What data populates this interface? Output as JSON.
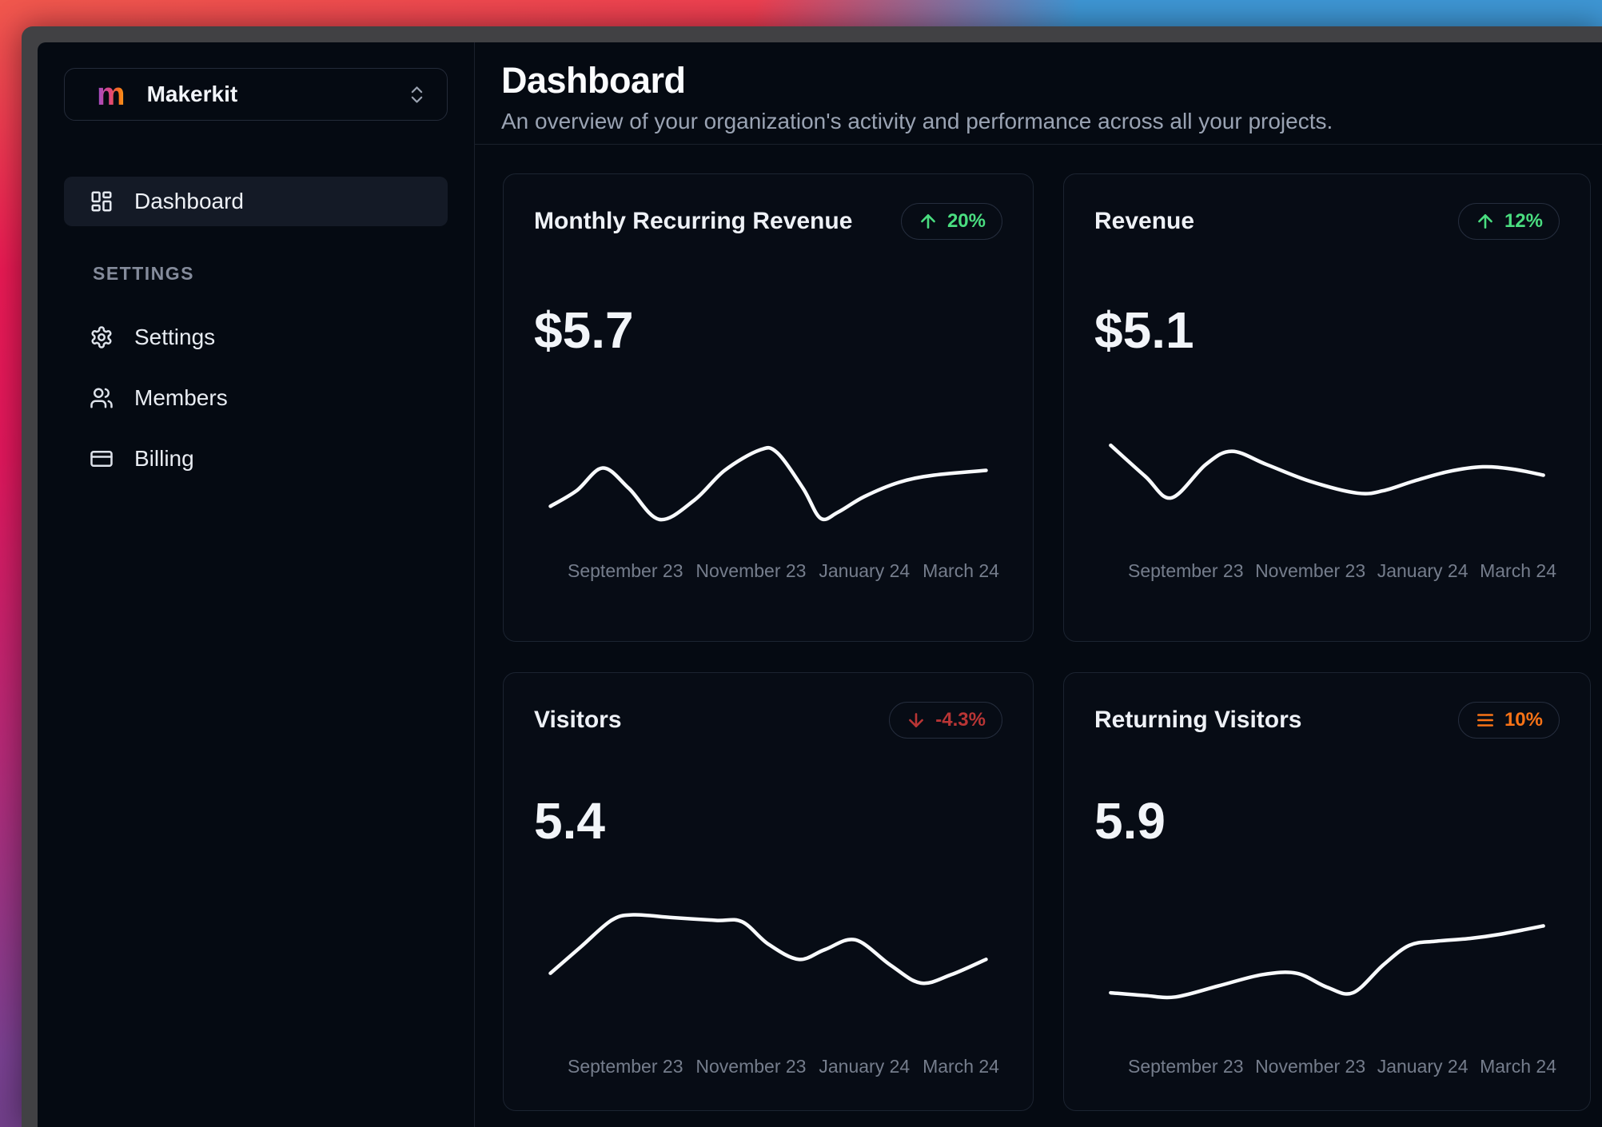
{
  "wallpaper": {
    "left_edge_colors": [
      "#f0584d",
      "#ea1a54",
      "#e0175c",
      "#b52a78",
      "#7a4192",
      "#53396f"
    ],
    "top_right_color": "#3e96d4"
  },
  "sidebar": {
    "workspace_selector": {
      "logo_letter": "m",
      "name": "Makerkit"
    },
    "nav": [
      {
        "label": "Dashboard",
        "icon": "layout-dashboard-icon",
        "active": true
      }
    ],
    "section_label": "SETTINGS",
    "settings_nav": [
      {
        "label": "Settings",
        "icon": "gear-icon"
      },
      {
        "label": "Members",
        "icon": "users-icon"
      },
      {
        "label": "Billing",
        "icon": "credit-card-icon"
      }
    ]
  },
  "header": {
    "title": "Dashboard",
    "subtitle": "An overview of your organization's activity and performance across all your projects."
  },
  "colors": {
    "trend_up": "#4ade80",
    "trend_down": "#b93535",
    "trend_flat": "#f97316",
    "spark_line": "#f8fafc"
  },
  "chart_data": [
    {
      "type": "line",
      "title": "Monthly Recurring Revenue",
      "value": "$5.7",
      "trend": {
        "icon": "arrow-up",
        "label": "20%",
        "color": "#4ade80"
      },
      "x_ticks": [
        "September 23",
        "November 23",
        "January 24",
        "March 24"
      ],
      "points_format": "[x percent of chart width, y percent of chart height (no numeric axis shown)]",
      "points_pct": [
        [
          0,
          25
        ],
        [
          6,
          38
        ],
        [
          12,
          57
        ],
        [
          18,
          40
        ],
        [
          25,
          14
        ],
        [
          33,
          30
        ],
        [
          40,
          55
        ],
        [
          48,
          72
        ],
        [
          52,
          70
        ],
        [
          58,
          40
        ],
        [
          62,
          15
        ],
        [
          66,
          20
        ],
        [
          72,
          33
        ],
        [
          80,
          45
        ],
        [
          88,
          51
        ],
        [
          100,
          55
        ]
      ]
    },
    {
      "type": "line",
      "title": "Revenue",
      "value": "$5.1",
      "trend": {
        "icon": "arrow-up",
        "label": "12%",
        "color": "#4ade80"
      },
      "x_ticks": [
        "September 23",
        "November 23",
        "January 24",
        "March 24"
      ],
      "points_format": "[x percent of chart width, y percent of chart height (no numeric axis shown)]",
      "points_pct": [
        [
          0,
          76
        ],
        [
          8,
          50
        ],
        [
          14,
          32
        ],
        [
          22,
          60
        ],
        [
          28,
          71
        ],
        [
          36,
          60
        ],
        [
          46,
          46
        ],
        [
          57,
          36
        ],
        [
          63,
          38
        ],
        [
          70,
          46
        ],
        [
          78,
          54
        ],
        [
          86,
          58
        ],
        [
          93,
          56
        ],
        [
          100,
          51
        ]
      ]
    },
    {
      "type": "line",
      "title": "Visitors",
      "value": "5.4",
      "trend": {
        "icon": "arrow-down",
        "label": "-4.3%",
        "color": "#b93535"
      },
      "x_ticks": [
        "September 23",
        "November 23",
        "January 24",
        "March 24"
      ],
      "points_format": "[x percent of chart width, y percent of chart height (no numeric axis shown)]",
      "points_pct": [
        [
          0,
          41
        ],
        [
          7,
          60
        ],
        [
          14,
          79
        ],
        [
          19,
          83
        ],
        [
          28,
          81
        ],
        [
          38,
          79
        ],
        [
          44,
          78
        ],
        [
          50,
          62
        ],
        [
          57,
          51
        ],
        [
          63,
          58
        ],
        [
          70,
          65
        ],
        [
          78,
          47
        ],
        [
          85,
          34
        ],
        [
          92,
          40
        ],
        [
          100,
          51
        ]
      ]
    },
    {
      "type": "line",
      "title": "Returning Visitors",
      "value": "5.9",
      "trend": {
        "icon": "menu",
        "label": "10%",
        "color": "#f97316"
      },
      "x_ticks": [
        "September 23",
        "November 23",
        "January 24",
        "March 24"
      ],
      "points_format": "[x percent of chart width, y percent of chart height (no numeric axis shown)]",
      "points_pct": [
        [
          0,
          27
        ],
        [
          8,
          25
        ],
        [
          15,
          24
        ],
        [
          25,
          32
        ],
        [
          35,
          40
        ],
        [
          43,
          41
        ],
        [
          50,
          31
        ],
        [
          56,
          27
        ],
        [
          63,
          47
        ],
        [
          69,
          61
        ],
        [
          75,
          64
        ],
        [
          83,
          66
        ],
        [
          90,
          69
        ],
        [
          100,
          75
        ]
      ]
    }
  ]
}
